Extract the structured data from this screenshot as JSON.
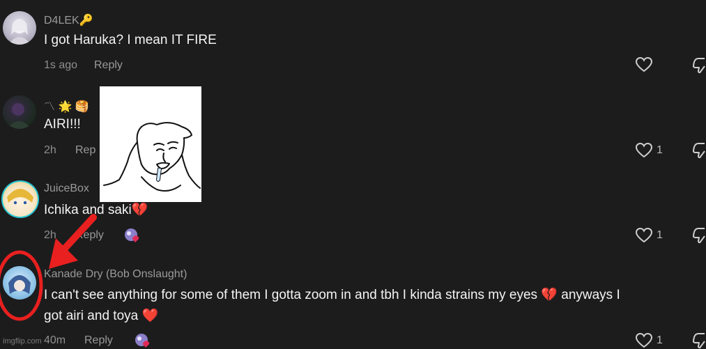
{
  "comments": [
    {
      "username": "D4LEK🔑",
      "text": "I got Haruka? I mean IT FIRE",
      "time": "1s ago",
      "reply": "Reply",
      "likes": ""
    },
    {
      "username": "〽 🌟 🥞",
      "text": "AIRI!!!",
      "time": "2h",
      "reply": "Rep",
      "likes": "1"
    },
    {
      "username": "JuiceBox",
      "text": "Ichika and saki💔",
      "time": "2h",
      "reply": "Reply",
      "likes": "1"
    },
    {
      "username": "Kanade Dry (Bob Onslaught)",
      "text_line1": "I can't see anything for some of them I gotta zoom in and tbh I kinda strains my eyes 💔 anyways I",
      "text_line2": "got airi and toya ❤️",
      "time": "40m",
      "reply": "Reply",
      "likes": "1"
    }
  ],
  "watermark": "imgflip.com",
  "colors": {
    "background": "#1c1c1d",
    "arrow": "#e8201f",
    "circle": "#e8201f"
  },
  "icons": [
    "heart-icon",
    "dislike-icon",
    "sticker-icon"
  ]
}
